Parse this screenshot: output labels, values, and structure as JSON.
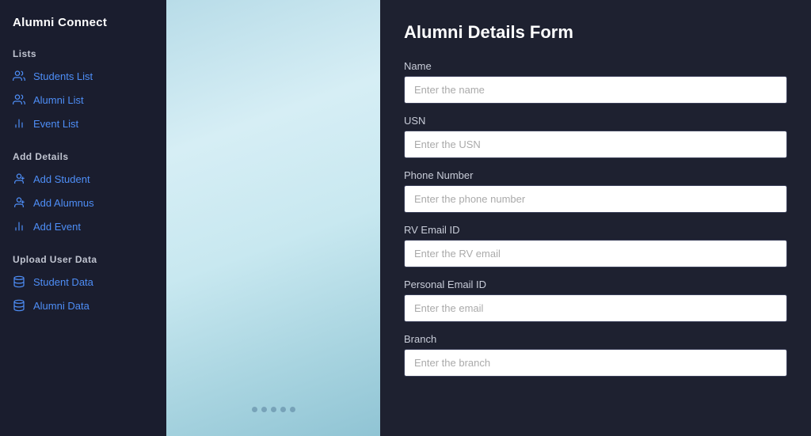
{
  "app": {
    "name": "Alumni Connect"
  },
  "sidebar": {
    "logo": "Alumni Connect",
    "sections": [
      {
        "label": "Lists",
        "items": [
          {
            "id": "students-list",
            "label": "Students List",
            "icon": "users"
          },
          {
            "id": "alumni-list",
            "label": "Alumni List",
            "icon": "users"
          },
          {
            "id": "event-list",
            "label": "Event List",
            "icon": "bar-chart"
          }
        ]
      },
      {
        "label": "Add Details",
        "items": [
          {
            "id": "add-student",
            "label": "Add Student",
            "icon": "user-plus"
          },
          {
            "id": "add-alumnus",
            "label": "Add Alumnus",
            "icon": "user-plus"
          },
          {
            "id": "add-event",
            "label": "Add Event",
            "icon": "bar-chart"
          }
        ]
      },
      {
        "label": "Upload User Data",
        "items": [
          {
            "id": "student-data",
            "label": "Student Data",
            "icon": "database"
          },
          {
            "id": "alumni-data",
            "label": "Alumni Data",
            "icon": "database"
          }
        ]
      }
    ]
  },
  "form": {
    "title": "Alumni Details Form",
    "fields": [
      {
        "id": "name",
        "label": "Name",
        "placeholder": "Enter the name"
      },
      {
        "id": "usn",
        "label": "USN",
        "placeholder": "Enter the USN"
      },
      {
        "id": "phone",
        "label": "Phone Number",
        "placeholder": "Enter the phone number"
      },
      {
        "id": "rv-email",
        "label": "RV Email ID",
        "placeholder": "Enter the RV email"
      },
      {
        "id": "personal-email",
        "label": "Personal Email ID",
        "placeholder": "Enter the email"
      },
      {
        "id": "branch",
        "label": "Branch",
        "placeholder": "Enter the branch"
      }
    ]
  }
}
